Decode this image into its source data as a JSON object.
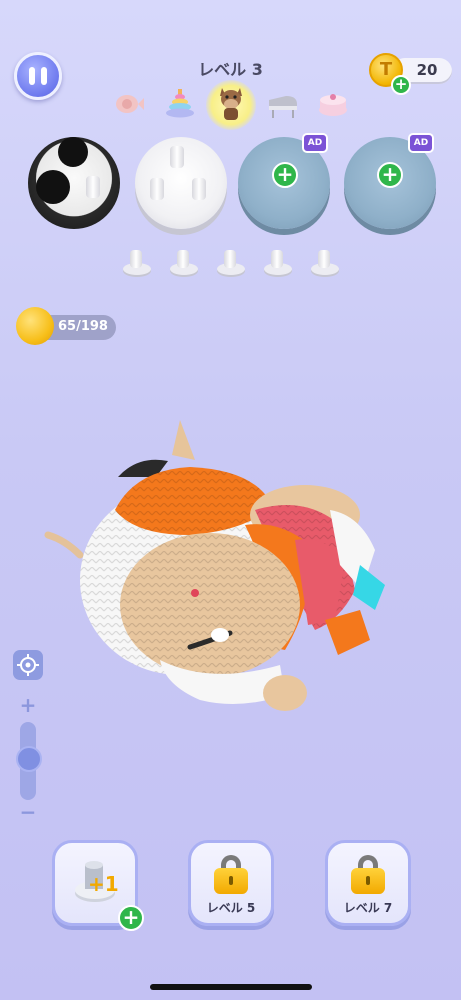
{
  "header": {
    "level_title": "レベル 3",
    "coins": "20",
    "coin_glyph": "T",
    "plus_glyph": "+"
  },
  "levels": {
    "icons": [
      "yarn-fish-icon",
      "stacking-rings-icon",
      "horse-icon",
      "piano-icon",
      "cake-icon"
    ],
    "current_index": 2
  },
  "slots": {
    "ad_label": "AD",
    "add_glyph": "+"
  },
  "yarn": {
    "progress": "65/198",
    "used": 65,
    "total": 198
  },
  "zoom": {
    "plus": "+",
    "minus": "−",
    "level": 0.5
  },
  "bottom": {
    "add_peg_label": "+1",
    "locked1_label": "レベル 5",
    "locked2_label": "レベル 7"
  },
  "colors": {
    "accent": "#6d79ee",
    "green": "#2fb64a",
    "gold": "#f2b500",
    "ad_purple": "#7b53d6"
  }
}
